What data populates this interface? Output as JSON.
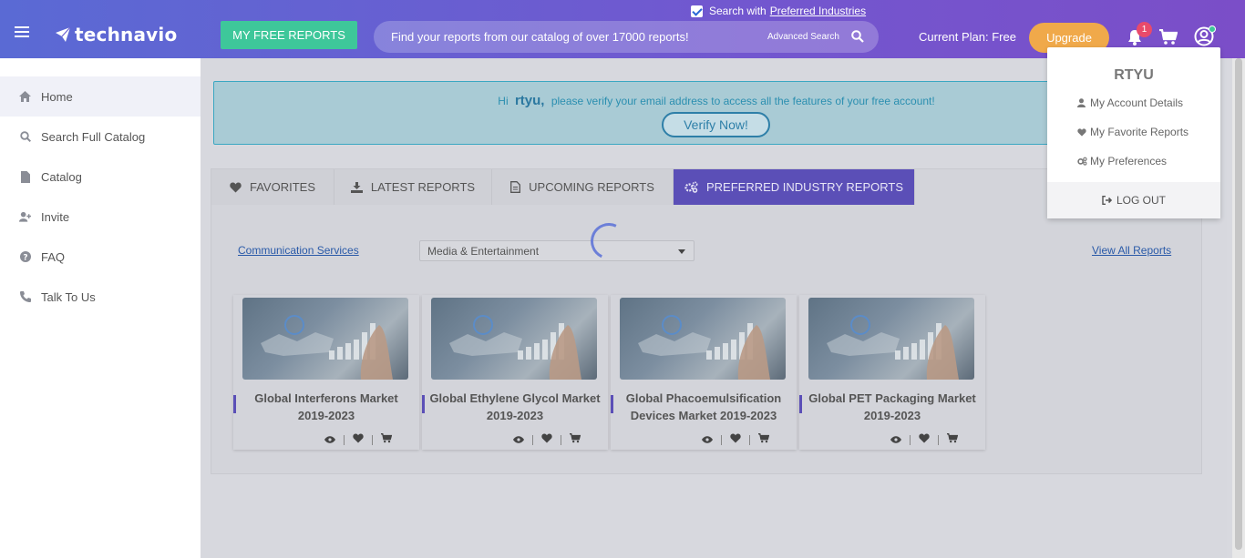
{
  "header": {
    "logo_text": "technavio",
    "free_reports_label": "MY FREE REPORTS",
    "preferred_checkbox_prefix": "Search with",
    "preferred_checkbox_link": "Preferred Industries",
    "search_placeholder": "Find your reports from our catalog of over 17000 reports!",
    "advanced_search_label": "Advanced Search",
    "current_plan": "Current Plan: Free",
    "upgrade_label": "Upgrade",
    "notification_count": "1"
  },
  "sidebar": {
    "items": [
      {
        "label": "Home",
        "icon": "home-icon"
      },
      {
        "label": "Search Full Catalog",
        "icon": "search-icon"
      },
      {
        "label": "Catalog",
        "icon": "document-icon"
      },
      {
        "label": "Invite",
        "icon": "user-plus-icon"
      },
      {
        "label": "FAQ",
        "icon": "question-icon"
      },
      {
        "label": "Talk To Us",
        "icon": "phone-icon"
      }
    ]
  },
  "verify": {
    "greeting": "Hi",
    "username": "rtyu,",
    "message": "please verify your email address to access all the features of your free account!",
    "button_label": "Verify Now!"
  },
  "tabs": [
    {
      "label": "FAVORITES",
      "icon": "heart-icon"
    },
    {
      "label": "LATEST REPORTS",
      "icon": "download-icon"
    },
    {
      "label": "UPCOMING REPORTS",
      "icon": "file-icon"
    },
    {
      "label": "PREFERRED INDUSTRY REPORTS",
      "icon": "gears-icon"
    }
  ],
  "filters": {
    "industry_link": "Communication Services",
    "subindustry_selected": "Media & Entertainment",
    "view_all_label": "View All Reports"
  },
  "reports": [
    {
      "title": "Global Interferons Market 2019-2023"
    },
    {
      "title": "Global Ethylene Glycol Market 2019-2023"
    },
    {
      "title": "Global Phacoemulsification Devices Market 2019-2023"
    },
    {
      "title": "Global PET Packaging Market 2019-2023"
    }
  ],
  "profile_menu": {
    "username": "RTYU",
    "items": [
      {
        "label": "My Account Details",
        "icon": "user-icon"
      },
      {
        "label": "My Favorite Reports",
        "icon": "heart-icon"
      },
      {
        "label": "My Preferences",
        "icon": "gears-icon"
      }
    ],
    "logout_label": "LOG OUT"
  },
  "colors": {
    "header_gradient_start": "#5a6ad4",
    "header_gradient_end": "#7b4ec8",
    "free_reports_green": "#3ec79a",
    "upgrade_orange": "#f0a94a",
    "active_tab_purple": "#5b4fb7",
    "badge_red": "#e94a6b"
  }
}
